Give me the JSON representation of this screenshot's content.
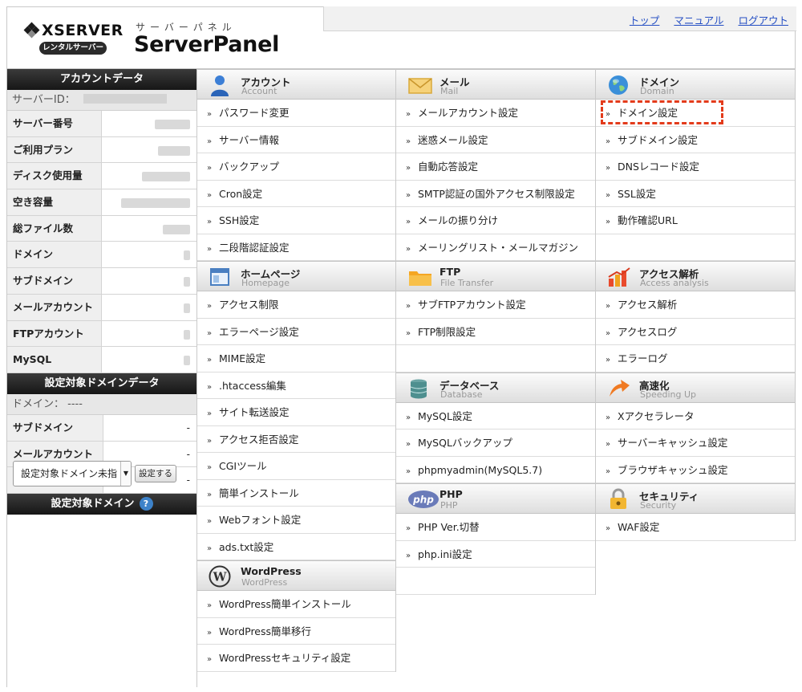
{
  "header": {
    "brand": "XSERVER",
    "rental_badge": "レンタルサーバー",
    "panel_kana": "サーバーパネル",
    "panel_name": "ServerPanel",
    "links": [
      "トップ",
      "マニュアル",
      "ログアウト"
    ]
  },
  "sidebar": {
    "account_title": "アカウントデータ",
    "server_id_label": "サーバーID：",
    "account_rows": [
      "サーバー番号",
      "ご利用プラン",
      "ディスク使用量",
      "空き容量",
      "総ファイル数",
      "ドメイン",
      "サブドメイン",
      "メールアカウント",
      "FTPアカウント",
      "MySQL"
    ],
    "domain_data_title": "設定対象ドメインデータ",
    "domain_label": "ドメイン： ----",
    "domain_rows": [
      {
        "label": "サブドメイン",
        "value": "-"
      },
      {
        "label": "メールアカウント",
        "value": "-"
      },
      {
        "label": "FTPアカウント",
        "value": "-"
      }
    ],
    "target_domain_title": "設定対象ドメイン",
    "help_glyph": "?",
    "select_value": "設定対象ドメイン未指",
    "set_button": "設定する"
  },
  "sections": {
    "account": {
      "title": "アカウント",
      "sub": "Account",
      "icon": "account-icon",
      "items": [
        "パスワード変更",
        "サーバー情報",
        "バックアップ",
        "Cron設定",
        "SSH設定",
        "二段階認証設定"
      ]
    },
    "homepage": {
      "title": "ホームページ",
      "sub": "Homepage",
      "icon": "homepage-icon",
      "items": [
        "アクセス制限",
        "エラーページ設定",
        "MIME設定",
        ".htaccess編集",
        "サイト転送設定",
        "アクセス拒否設定",
        "CGIツール",
        "簡単インストール",
        "Webフォント設定",
        "ads.txt設定"
      ]
    },
    "wordpress": {
      "title": "WordPress",
      "sub": "WordPress",
      "icon": "wordpress-icon",
      "items": [
        "WordPress簡単インストール",
        "WordPress簡単移行",
        "WordPressセキュリティ設定"
      ]
    },
    "mail": {
      "title": "メール",
      "sub": "Mail",
      "icon": "mail-icon",
      "items": [
        "メールアカウント設定",
        "迷惑メール設定",
        "自動応答設定",
        "SMTP認証の国外アクセス制限設定",
        "メールの振り分け",
        "メーリングリスト・メールマガジン"
      ]
    },
    "ftp": {
      "title": "FTP",
      "sub": "File Transfer",
      "icon": "folder-icon",
      "items": [
        "サブFTPアカウント設定",
        "FTP制限設定"
      ]
    },
    "database": {
      "title": "データベース",
      "sub": "Database",
      "icon": "database-icon",
      "items": [
        "MySQL設定",
        "MySQLバックアップ",
        "phpmyadmin(MySQL5.7)"
      ]
    },
    "php": {
      "title": "PHP",
      "sub": "PHP",
      "icon": "php-icon",
      "items": [
        "PHP Ver.切替",
        "php.ini設定"
      ]
    },
    "domain": {
      "title": "ドメイン",
      "sub": "Domain",
      "icon": "globe-icon",
      "items": [
        "ドメイン設定",
        "サブドメイン設定",
        "DNSレコード設定",
        "SSL設定",
        "動作確認URL"
      ]
    },
    "access": {
      "title": "アクセス解析",
      "sub": "Access analysis",
      "icon": "chart-icon",
      "items": [
        "アクセス解析",
        "アクセスログ",
        "エラーログ"
      ]
    },
    "speed": {
      "title": "高速化",
      "sub": "Speeding Up",
      "icon": "speed-arrow-icon",
      "items": [
        "Xアクセラレータ",
        "サーバーキャッシュ設定",
        "ブラウザキャッシュ設定"
      ]
    },
    "security": {
      "title": "セキュリティ",
      "sub": "Security",
      "icon": "lock-icon",
      "items": [
        "WAF設定"
      ]
    }
  },
  "chevron_glyph": "»",
  "colors": {
    "link": "#2650c4",
    "highlight": "#e33b1b",
    "dark_header": "#1f1f1f"
  }
}
